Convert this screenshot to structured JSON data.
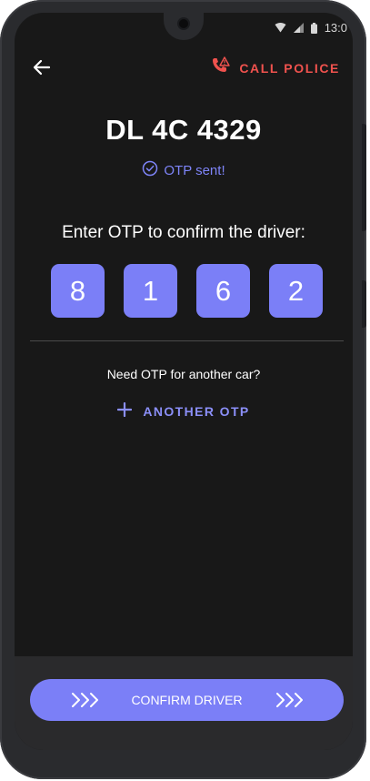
{
  "status_bar": {
    "time": "13:0",
    "icons": [
      "wifi-icon",
      "cellular-signal-icon",
      "battery-icon"
    ]
  },
  "header": {
    "back_icon": "back-arrow-icon",
    "call_police_icon": "phone-alert-icon",
    "call_police_label": "CALL POLICE"
  },
  "main": {
    "plate": "DL 4C 4329",
    "otp_sent_icon": "check-circle-icon",
    "otp_sent_text": "OTP sent!",
    "prompt": "Enter OTP to confirm the driver:",
    "otp_digits": [
      "8",
      "1",
      "6",
      "2"
    ],
    "need_otp_text": "Need OTP for another car?",
    "another_otp_icon": "plus-icon",
    "another_otp_label": "ANOTHER OTP"
  },
  "footer": {
    "confirm_label": "CONFIRM DRIVER",
    "chevron_icon": "triple-chevron-right-icon"
  },
  "colors": {
    "accent": "#7b7ff7",
    "danger": "#f0524e",
    "background": "#181818"
  }
}
